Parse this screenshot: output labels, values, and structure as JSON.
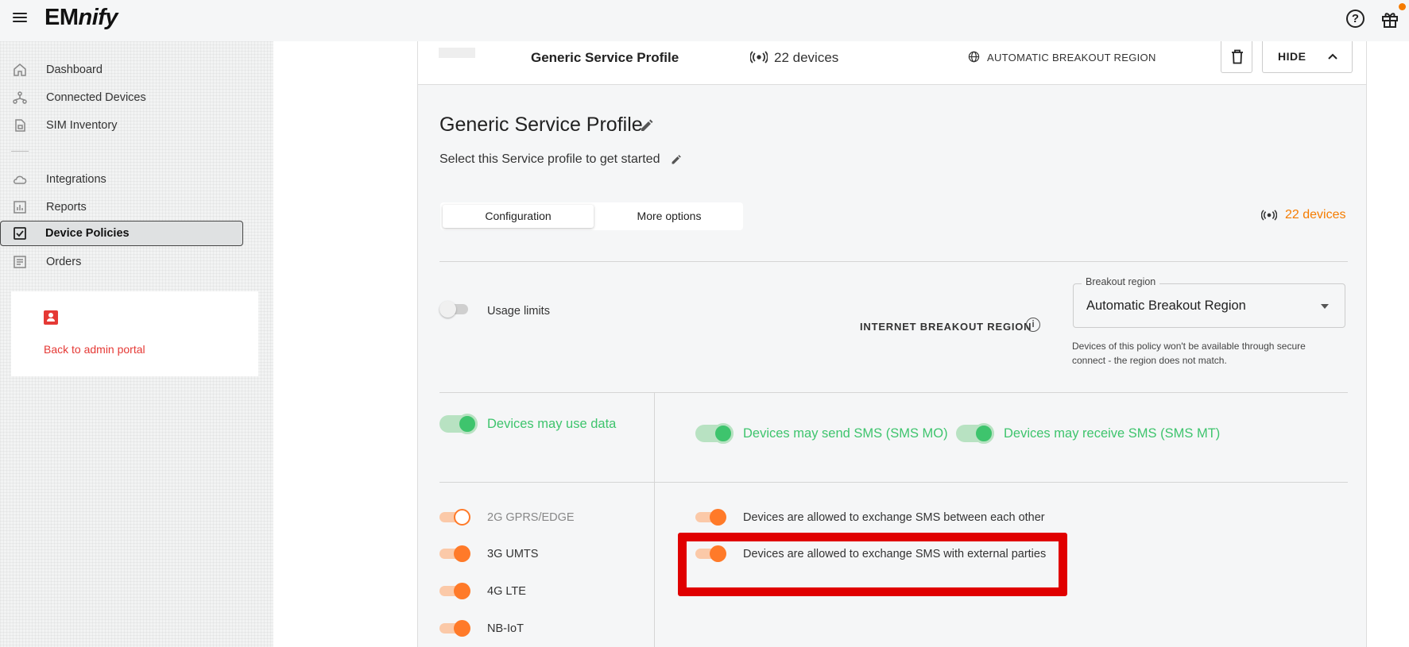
{
  "app": {
    "logo": "EMnify",
    "logo_main": "EM",
    "logo_italic": "nify"
  },
  "topbar": {
    "help_icon": "help-icon",
    "gift_icon": "gift-icon",
    "notification_color": "#f57c00"
  },
  "sidebar": {
    "items": [
      {
        "label": "Dashboard",
        "icon": "home-icon"
      },
      {
        "label": "Connected Devices",
        "icon": "network-icon"
      },
      {
        "label": "SIM Inventory",
        "icon": "sim-icon"
      },
      {
        "label": "Integrations",
        "icon": "cloud-icon"
      },
      {
        "label": "Reports",
        "icon": "chart-icon"
      },
      {
        "label": "Device Policies",
        "icon": "checkbox-icon"
      },
      {
        "label": "Orders",
        "icon": "document-icon"
      }
    ],
    "active_item": "Device Policies",
    "admin_link": "Back to admin portal"
  },
  "profile_header": {
    "name": "Generic Service Profile",
    "devices": "22 devices",
    "region": "AUTOMATIC BREAKOUT REGION",
    "hide_label": "HIDE"
  },
  "profile": {
    "title": "Generic Service Profile",
    "subtitle": "Select this Service profile to get started",
    "tabs": [
      {
        "label": "Configuration",
        "active": true
      },
      {
        "label": "More options",
        "active": false
      }
    ],
    "device_count": "22 devices",
    "usage_limits": {
      "label": "Usage limits",
      "on": false
    },
    "internet_breakout_label": "INTERNET BREAKOUT REGION",
    "breakout_region": {
      "legend": "Breakout region",
      "value": "Automatic Breakout Region",
      "help": "Devices of this policy won't be available through secure connect - the region does not match."
    },
    "data_toggle": {
      "label": "Devices may use data",
      "on": true
    },
    "sms_mo": {
      "label": "Devices may send SMS (SMS MO)",
      "on": true
    },
    "sms_mt": {
      "label": "Devices may receive SMS (SMS MT)",
      "on": true
    },
    "technologies": [
      {
        "label": "2G GPRS/EDGE",
        "on": false
      },
      {
        "label": "3G UMTS",
        "on": true
      },
      {
        "label": "4G LTE",
        "on": true
      },
      {
        "label": "NB-IoT",
        "on": true
      }
    ],
    "sms_options": [
      {
        "label": "Devices are allowed to exchange SMS between each other",
        "on": true
      },
      {
        "label": "Devices are allowed to exchange SMS with external parties",
        "on": true
      }
    ]
  },
  "colors": {
    "accent_orange": "#ff7a29",
    "accent_green": "#3ec46d",
    "highlight_red": "#e00000",
    "admin_red": "#e53935"
  }
}
